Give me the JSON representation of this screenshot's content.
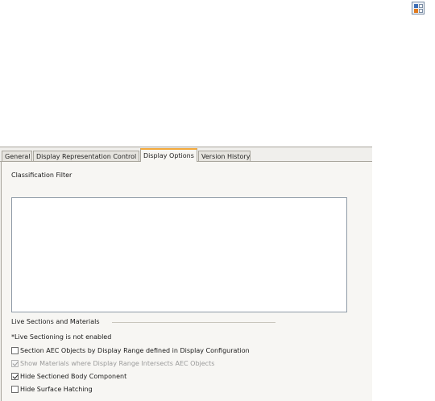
{
  "colors": {
    "active_tab_accent": "#f3a83a",
    "panel_bg": "#f0efec"
  },
  "top_icon": "dialog-settings-icon",
  "tabs": [
    {
      "label": "General",
      "active": false
    },
    {
      "label": "Display Representation Control",
      "active": false
    },
    {
      "label": "Display Options",
      "active": true
    },
    {
      "label": "Version History",
      "active": false
    }
  ],
  "classification_filter": {
    "label": "Classification Filter",
    "items": []
  },
  "live_sections": {
    "heading": "Live Sections and Materials",
    "status_note": "*Live Sectioning is not enabled",
    "options": [
      {
        "label": "Section AEC Objects by Display Range defined in Display Configuration",
        "checked": false,
        "enabled": true
      },
      {
        "label": "Show Materials where Display Range Intersects AEC Objects",
        "checked": true,
        "enabled": false
      },
      {
        "label": "Hide Sectioned Body Component",
        "checked": true,
        "enabled": true
      },
      {
        "label": "Hide Surface Hatching",
        "checked": false,
        "enabled": true
      }
    ]
  }
}
